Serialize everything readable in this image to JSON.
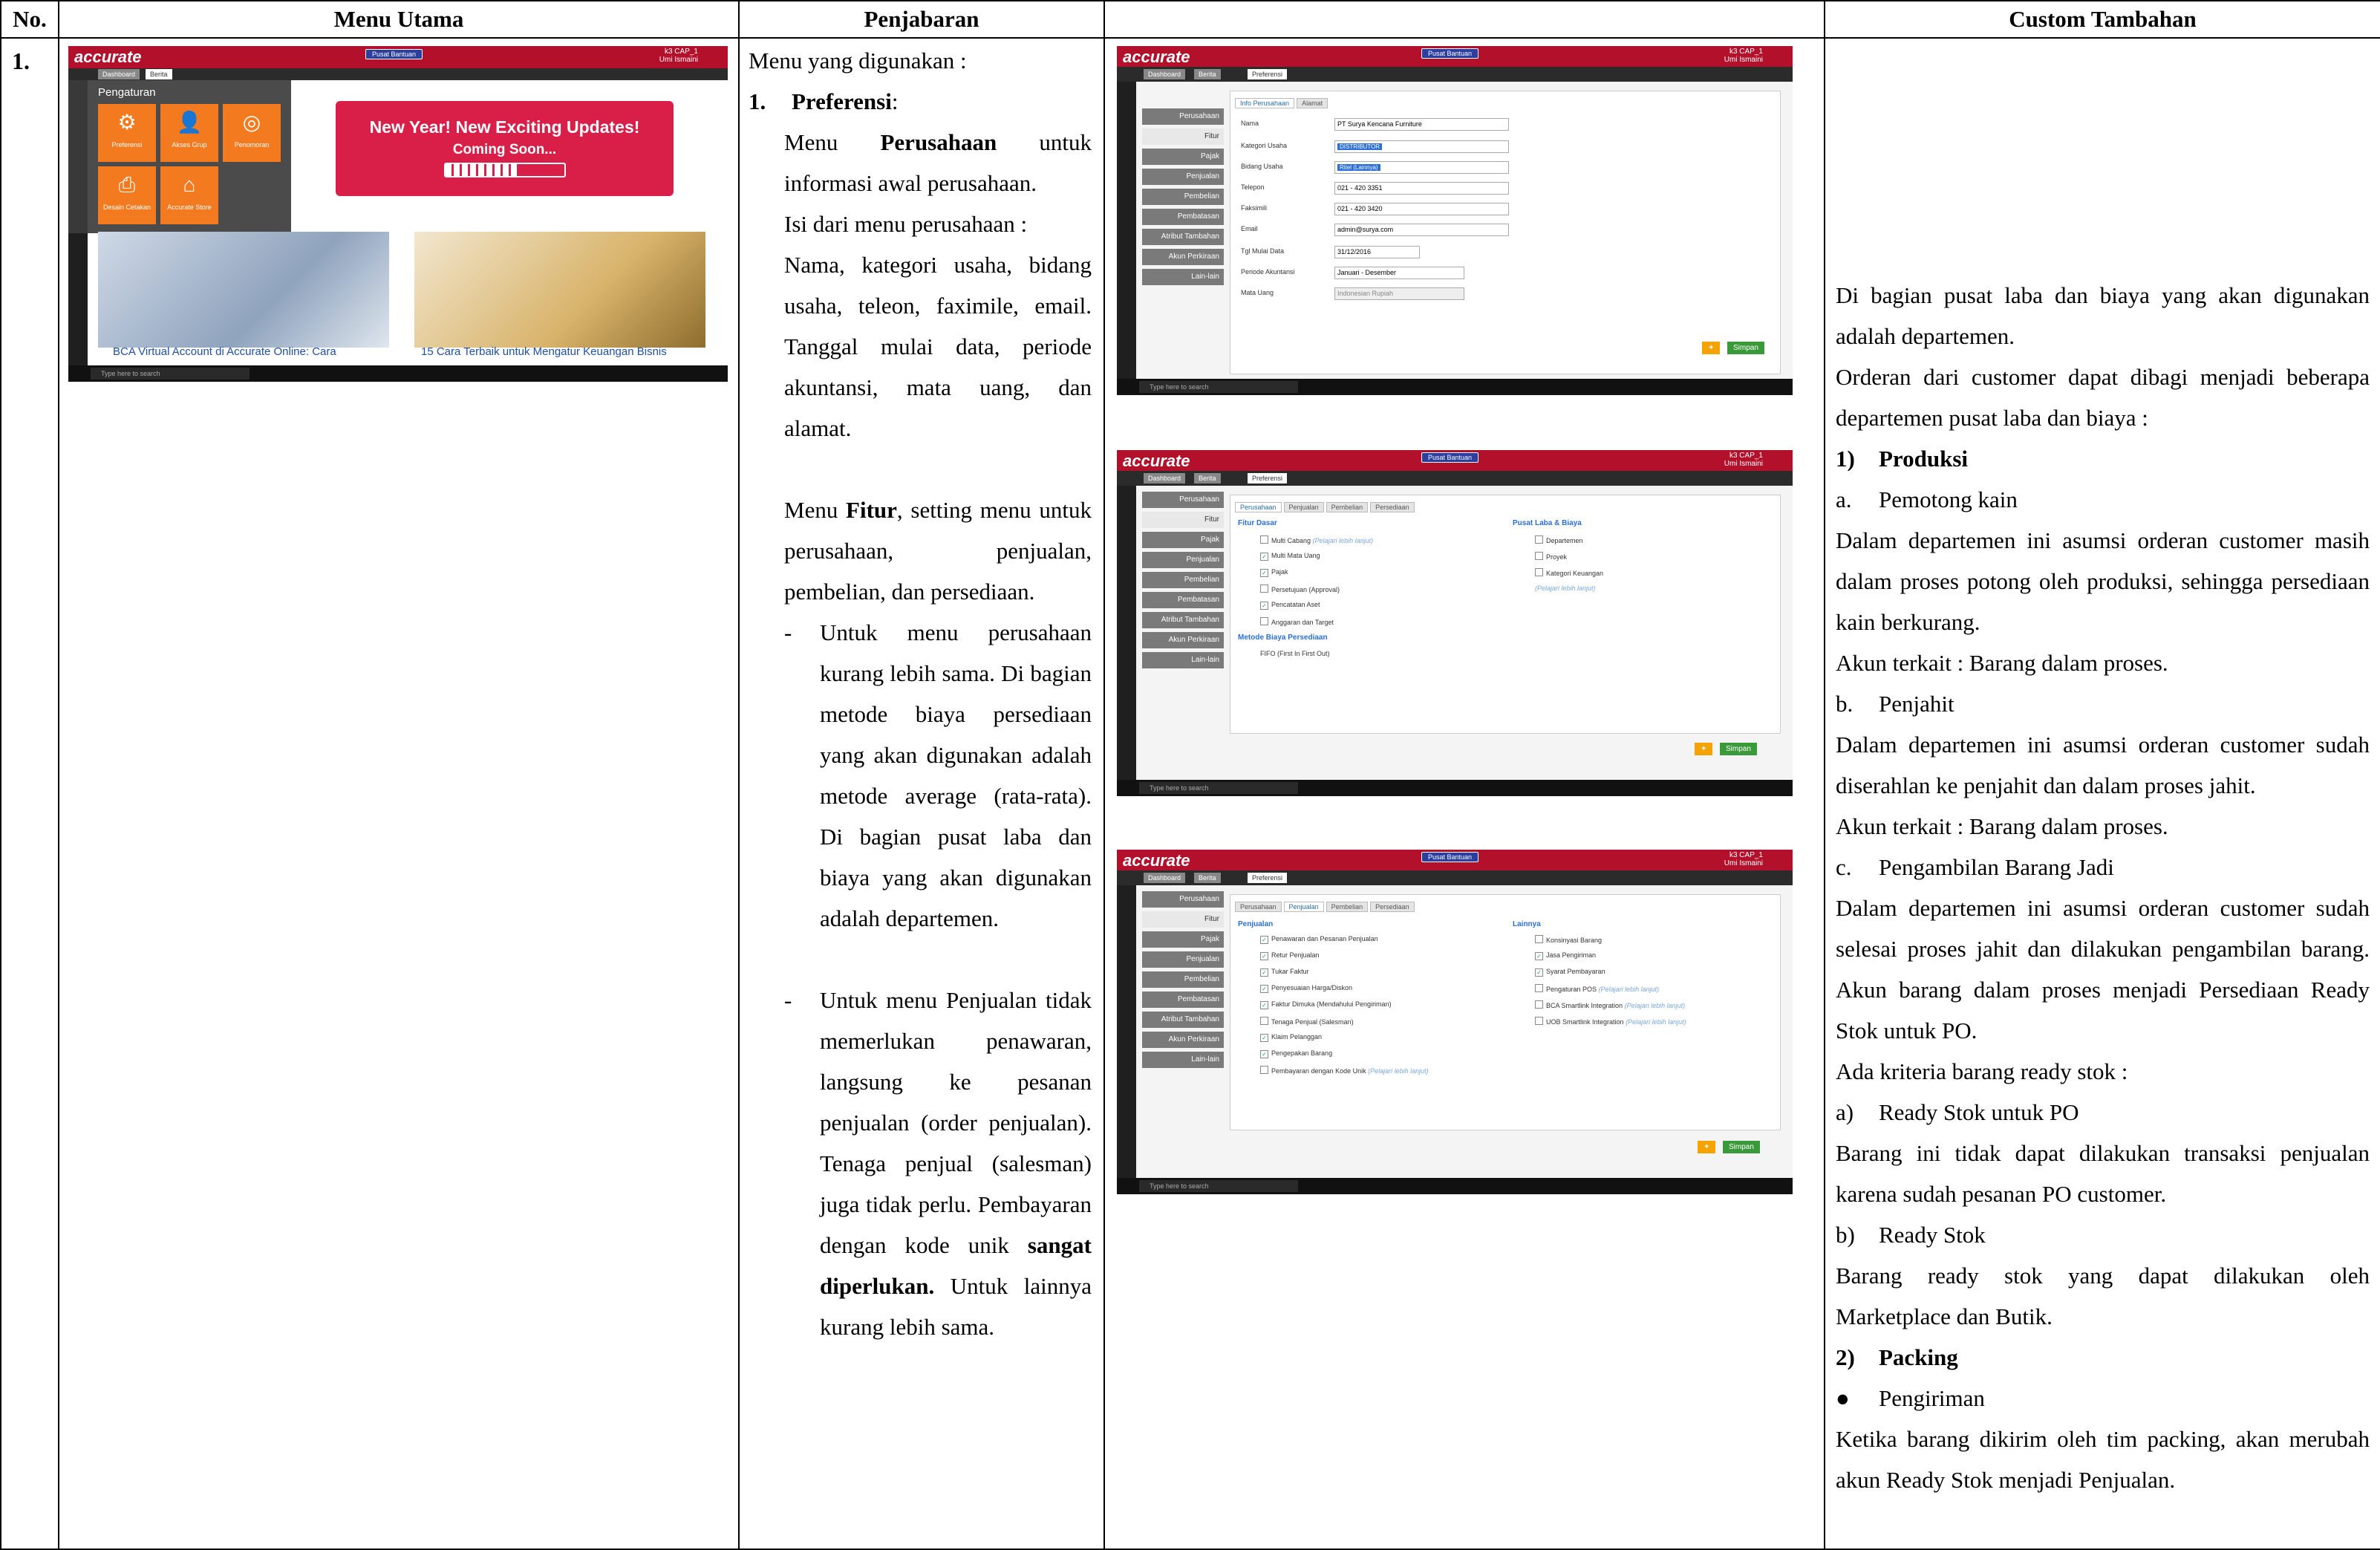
{
  "headers": {
    "no": "No.",
    "menu_utama": "Menu Utama",
    "penjabaran": "Penjabaran",
    "custom": "Custom Tambahan"
  },
  "row": {
    "number": "1.",
    "penjabaran": {
      "intro": "Menu yang digunakan :",
      "item_no": "1.",
      "item_title": "Preferensi",
      "item_colon": ":",
      "p1_pre": "Menu ",
      "p1_bold": "Perusahaan",
      "p1_post": " untuk informasi awal perusahaan.",
      "p2": "Isi dari menu perusahaan :",
      "p3": "Nama, kategori usaha, bidang usaha, teleon, faximile, email. Tanggal mulai data, periode akuntansi, mata uang, dan alamat.",
      "p4_pre": "Menu ",
      "p4_bold": "Fitur",
      "p4_post": ", setting menu untuk perusahaan, penjualan, pembelian, dan persediaan.",
      "dash": "-",
      "b1": "Untuk menu perusahaan kurang lebih sama. Di bagian metode biaya persediaan yang akan digunakan adalah metode average (rata-rata). Di bagian pusat laba dan biaya yang akan digunakan adalah departemen.",
      "b2_pre": "Untuk menu Penjualan tidak memerlukan penawaran, langsung ke pesanan penjualan (order penjualan). Tenaga penjual (salesman) juga tidak perlu. Pembayaran dengan kode unik ",
      "b2_bold": "sangat diperlukan.",
      "b2_post": " Untuk lainnya kurang lebih sama."
    },
    "custom": {
      "c1": "Di bagian pusat laba dan biaya yang akan digunakan adalah departemen.",
      "c2": "Orderan dari customer dapat dibagi menjadi beberapa departemen pusat laba dan biaya  :",
      "s1_no": "1)",
      "s1_title": "Produksi",
      "a_no": "a.",
      "a_title": "Pemotong kain",
      "a_desc": "Dalam departemen ini asumsi orderan customer masih dalam proses potong oleh produksi, sehingga persediaan kain berkurang.",
      "a_akun": "Akun terkait : Barang dalam proses.",
      "b_no": "b.",
      "b_title": "Penjahit",
      "b_desc": "Dalam departemen ini asumsi orderan customer sudah diserahlan ke penjahit dan dalam proses jahit.",
      "b_akun": "Akun terkait : Barang dalam proses.",
      "c_no": "c.",
      "c_title": "Pengambilan Barang Jadi",
      "c_desc": "Dalam departemen ini asumsi orderan customer sudah selesai proses jahit dan dilakukan pengambilan barang. Akun barang dalam proses menjadi Persediaan Ready Stok untuk PO.",
      "krit": "Ada kriteria barang ready stok :",
      "ka_no": "a)",
      "ka_title": "Ready Stok untuk PO",
      "ka_desc": "Barang ini tidak dapat dilakukan transaksi penjualan karena sudah pesanan PO customer.",
      "kb_no": "b)",
      "kb_title": "Ready Stok",
      "kb_desc": "Barang ready stok yang dapat dilakukan oleh Marketplace dan Butik.",
      "s2_no": "2)",
      "s2_title": "Packing",
      "bullet": "●",
      "pg_title": "Pengiriman",
      "pg_desc": "Ketika barang dikirim oleh tim packing, akan merubah akun Ready Stok menjadi Penjualan."
    }
  },
  "app": {
    "logo": "accurate",
    "help": "Pusat Bantuan",
    "user": "k3 CAP_1",
    "user_sub": "Umi Ismaini",
    "tab_dashboard": "Dashboard",
    "tab_berita": "Berita",
    "tab_preferensi": "Preferensi",
    "taskbar_search": "Type here to search",
    "pengaturan": "Pengaturan",
    "tiles": [
      "Preferensi",
      "Akses Grup",
      "Penomoran",
      "Desain Cetakan",
      "Accurate Store"
    ],
    "banner_title": "New Year! New Exciting Updates!",
    "banner_sub": "Coming Soon...",
    "news1": "BCA Virtual Account di Accurate Online: Cara",
    "news2": "15 Cara Terbaik untuk Mengatur Keuangan Bisnis",
    "menu": [
      "Perusahaan",
      "Fitur",
      "Pajak",
      "Penjualan",
      "Pembelian",
      "Pembatasan",
      "Atribut Tambahan",
      "Akun Perkiraan",
      "Lain-lain"
    ],
    "ptabs_perusahaan": [
      "Info Perusahaan",
      "Alamat"
    ],
    "ptabs_fitur": [
      "Perusahaan",
      "Penjualan",
      "Pembelian",
      "Persediaan"
    ],
    "form": {
      "labels": [
        "Nama",
        "Kategori Usaha",
        "Bidang Usaha",
        "Telepon",
        "Faksimili",
        "Email",
        "Tgl Mulai Data",
        "Periode Akuntansi",
        "Mata Uang"
      ],
      "values": [
        "PT Surya Kencana Furniture",
        "DISTRIBUTOR",
        "Ritel (Lainnya)",
        "021 - 420 3351",
        "021 - 420 3420",
        "admin@surya.com",
        "31/12/2016",
        "Januari - Desember",
        "Indonesian Rupiah"
      ]
    },
    "save": "Simpan",
    "fitur_dasar": "Fitur Dasar",
    "fitur_items": [
      "Multi Cabang",
      "Multi Mata Uang",
      "Pajak",
      "Persetujuan (Approval)",
      "Pencatatan Aset",
      "Anggaran dan Target"
    ],
    "pusat_laba": "Pusat Laba & Biaya",
    "pusat_items": [
      "Departemen",
      "Proyek",
      "Kategori Keuangan"
    ],
    "metode": "Metode Biaya Persediaan",
    "metode_val": "FIFO (First In First Out)",
    "learn": "(Pelajari lebih lanjut)",
    "penjualan_hd": "Penjualan",
    "penjualan_items": [
      "Penawaran dan Pesanan Penjualan",
      "Retur Penjualan",
      "Tukar Faktur",
      "Penyesuaian Harga/Diskon",
      "Faktur Dimuka (Mendahului Pengiriman)",
      "Tenaga Penjual (Salesman)",
      "Klaim Pelanggan",
      "Pengepakan Barang",
      "Pembayaran dengan Kode Unik"
    ],
    "lainnya_hd": "Lainnya",
    "lainnya_items": [
      "Konsinyasi Barang",
      "Jasa Pengiriman",
      "Syarat Pembayaran",
      "Pengaturan POS",
      "BCA Smartlink Integration",
      "UOB Smartlink Integration"
    ]
  }
}
